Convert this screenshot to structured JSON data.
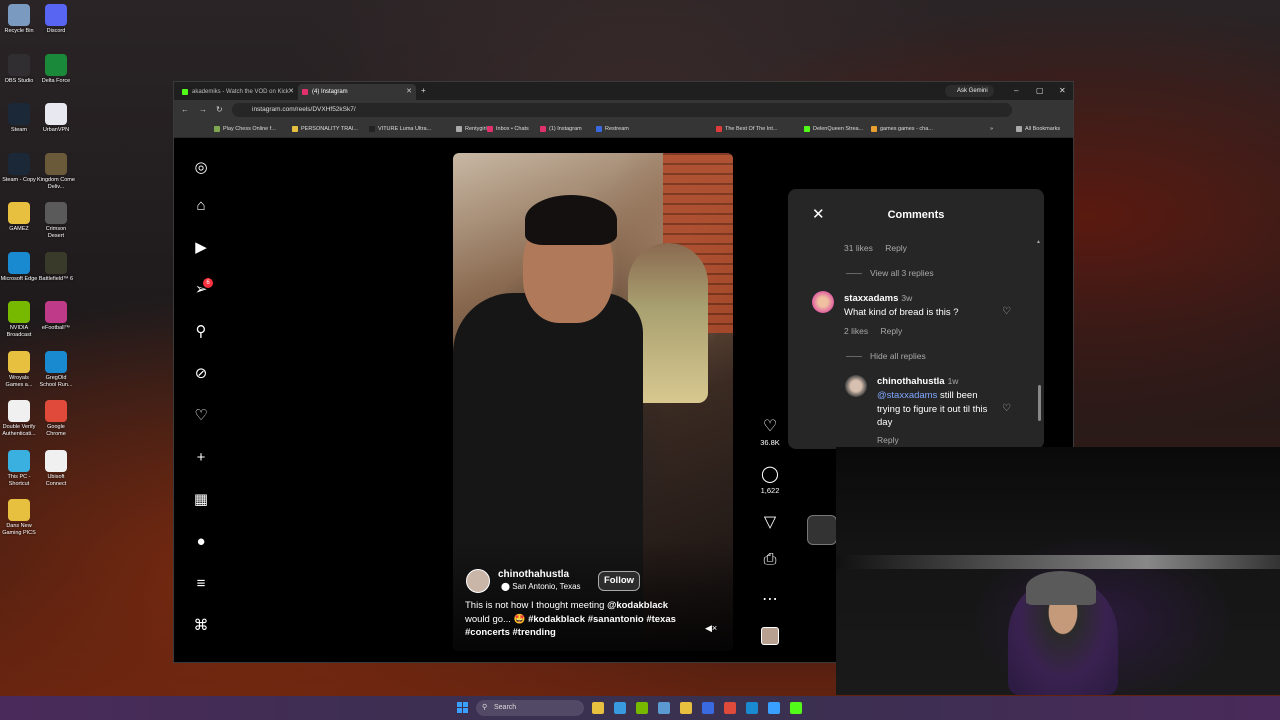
{
  "desktop": {
    "icons": [
      {
        "label": "Recycle Bin",
        "color": "#7a9ac0"
      },
      {
        "label": "Discord",
        "color": "#5865f2"
      },
      {
        "label": "OBS Studio",
        "color": "#302e31"
      },
      {
        "label": "Delta Force",
        "color": "#1a8a3a"
      },
      {
        "label": "Steam",
        "color": "#1b2838"
      },
      {
        "label": "UrbanVPN",
        "color": "#e8e8f0"
      },
      {
        "label": "Steam - Copy",
        "color": "#1b2838"
      },
      {
        "label": "Kingdom Come Deliv...",
        "color": "#6a5a3a"
      },
      {
        "label": "GAMEZ",
        "color": "#e8c040"
      },
      {
        "label": "Crimson Desert",
        "color": "#5a5a5a"
      },
      {
        "label": "Microsoft Edge",
        "color": "#1a8ad0"
      },
      {
        "label": "Battlefield™ 6",
        "color": "#3a3a2a"
      },
      {
        "label": "NVIDIA Broadcast",
        "color": "#76b900"
      },
      {
        "label": "eFootball™",
        "color": "#c03a8a"
      },
      {
        "label": "Wroyals Games a...",
        "color": "#e8c040"
      },
      {
        "label": "GregOld School Run...",
        "color": "#1a8ad0"
      },
      {
        "label": "Double Verify Authenticati...",
        "color": "#f0f0f0"
      },
      {
        "label": "Google Chrome",
        "color": "#e04a3a"
      },
      {
        "label": "This PC - Shortcut",
        "color": "#3ab0e0"
      },
      {
        "label": "Ubisoft Connect",
        "color": "#f0f0f0"
      },
      {
        "label": "Dans New Gaming PICS",
        "color": "#e8c040"
      }
    ]
  },
  "browser": {
    "tabs": [
      {
        "label": "akademiks - Watch the VOD on Kick",
        "color": "#53fc18"
      },
      {
        "label": "(4) Instagram",
        "color": "#e1306c"
      }
    ],
    "new_tab": "+",
    "ask_gemini": "Ask Gemini",
    "window_controls": {
      "minimize": "–",
      "maximize": "▢",
      "close": "✕"
    },
    "nav": {
      "back": "←",
      "forward": "→",
      "reload": "↻"
    },
    "url": "instagram.com/reels/DVXHf52kSk7/",
    "bookmarks": [
      {
        "label": "Play Chess Online f...",
        "color": "#7fa650"
      },
      {
        "label": "PERSONALITY TRAI...",
        "color": "#e8c040"
      },
      {
        "label": "VITURE Luma Ultra...",
        "color": "#222"
      },
      {
        "label": "Rentygirl",
        "color": "#aaa"
      },
      {
        "label": "Inbox • Chats",
        "color": "#e1306c"
      },
      {
        "label": "(1) Instagram",
        "color": "#e1306c"
      },
      {
        "label": "Restream",
        "color": "#3a6ae0"
      },
      {
        "label": "The Best Of The Int...",
        "color": "#e03a3a"
      },
      {
        "label": "DelenQueen Strea...",
        "color": "#53fc18"
      },
      {
        "label": "games games - cha...",
        "color": "#e8a030"
      }
    ],
    "more_bookmarks": "»",
    "all_bookmarks": "All Bookmarks"
  },
  "instagram": {
    "sidebar": {
      "notification_count": "6"
    },
    "reel": {
      "username": "chinothahustla",
      "location": "San Antonio, Texas",
      "follow_label": "Follow",
      "caption_plain": "This is not how I thought meeting ",
      "caption_mention": "@kodakblack",
      "caption_rest": " would go... 🤩 ",
      "caption_tags": "#kodakblack #sanantonio #texas #concerts #trending",
      "likes": "36.8K",
      "comments": "1,622"
    },
    "comments_panel": {
      "title": "Comments",
      "first_meta": {
        "likes": "31 likes",
        "reply": "Reply"
      },
      "view_replies": "View all 3 replies",
      "comment": {
        "username": "staxxadams",
        "time": "3w",
        "text": "What kind of bread is this ?",
        "likes": "2 likes",
        "reply": "Reply"
      },
      "hide_replies": "Hide all replies",
      "reply": {
        "username": "chinothahustla",
        "time": "1w",
        "mention": "@staxxadams",
        "text": " still been trying to figure it out til this day",
        "reply": "Reply"
      }
    }
  },
  "taskbar": {
    "search_placeholder": "Search",
    "apps": [
      "#e8c040",
      "#3a9ae0",
      "#76b900",
      "#5a9ad0",
      "#e8c040",
      "#3a6ae0",
      "#e04a3a",
      "#1a8ad0",
      "#3aa0ff",
      "#53fc18"
    ]
  }
}
